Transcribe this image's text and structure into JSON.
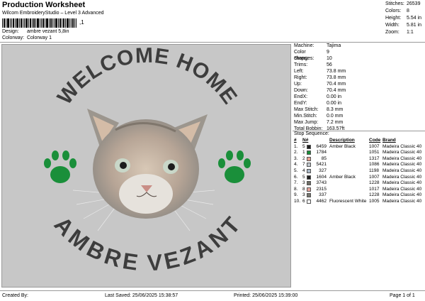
{
  "header": {
    "title": "Production Worksheet",
    "subtitle": "Wilcom EmbroideryStudio – Level 3 Advanced",
    "barcode_number": ",1",
    "design_label": "Design:",
    "design_value": "ambre vezant 5,8in",
    "colorway_label": "Colorway:",
    "colorway_value": "Colorway 1"
  },
  "stats": [
    {
      "label": "Stitches:",
      "value": "26539"
    },
    {
      "label": "Colors:",
      "value": "8"
    },
    {
      "label": "Height:",
      "value": "5.54 in"
    },
    {
      "label": "Width:",
      "value": "5.81 in"
    },
    {
      "label": "Zoom:",
      "value": "1:1"
    }
  ],
  "design": {
    "top_text": "WELCOME HOME",
    "bottom_text": "AMBRE VEZANT",
    "colors": {
      "background": "#c7c7c7",
      "text": "#3d3d3d",
      "paw": "#1a8f3a"
    }
  },
  "machine": [
    {
      "label": "Machine:",
      "value": "Tajima"
    },
    {
      "label": "Color changes:",
      "value": "9"
    },
    {
      "label": "Stops:",
      "value": "10"
    },
    {
      "label": "Trims:",
      "value": "56"
    },
    {
      "label": "Left:",
      "value": "73.8 mm"
    },
    {
      "label": "Right:",
      "value": "73.8 mm"
    },
    {
      "label": "Up:",
      "value": "70.4 mm"
    },
    {
      "label": "Down:",
      "value": "70.4 mm"
    },
    {
      "label": "EndX:",
      "value": "0.00 in"
    },
    {
      "label": "EndY:",
      "value": "0.00 in"
    },
    {
      "label": "Max Stitch:",
      "value": "8.3 mm"
    },
    {
      "label": "Min.Stitch:",
      "value": "0.0 mm"
    },
    {
      "label": "Max Jump:",
      "value": "7.2 mm"
    },
    {
      "label": "Total Bobbin:",
      "value": "163.57ft"
    }
  ],
  "sequence": {
    "title": "Stop Sequence:",
    "headers": {
      "num": "#",
      "n": "N#",
      "desc": "Description",
      "code": "Code",
      "brand": "Brand"
    },
    "rows": [
      {
        "num": "1.",
        "n": "5",
        "color": "#1f1f1f",
        "code_no": "6459",
        "desc": "Amber Black",
        "code": "1007",
        "brand": "Madeira Classic 40"
      },
      {
        "num": "2.",
        "n": "1",
        "color": "#1a8f3a",
        "code_no": "1784",
        "desc": "",
        "code": "1051",
        "brand": "Madeira Classic 40"
      },
      {
        "num": "3.",
        "n": "2",
        "color": "#e9a090",
        "code_no": "85",
        "desc": "",
        "code": "1317",
        "brand": "Madeira Classic 40"
      },
      {
        "num": "4.",
        "n": "7",
        "color": "#bfc6cc",
        "code_no": "5421",
        "desc": "",
        "code": "1086",
        "brand": "Madeira Classic 40"
      },
      {
        "num": "5.",
        "n": "4",
        "color": "#a9b8c6",
        "code_no": "327",
        "desc": "",
        "code": "1198",
        "brand": "Madeira Classic 40"
      },
      {
        "num": "6.",
        "n": "5",
        "color": "#1f1f1f",
        "code_no": "1604",
        "desc": "Amber Black",
        "code": "1007",
        "brand": "Madeira Classic 40"
      },
      {
        "num": "7.",
        "n": "3",
        "color": "#6e6e66",
        "code_no": "3743",
        "desc": "",
        "code": "1228",
        "brand": "Madeira Classic 40"
      },
      {
        "num": "8.",
        "n": "8",
        "color": "#e7a49a",
        "code_no": "2315",
        "desc": "",
        "code": "1017",
        "brand": "Madeira Classic 40"
      },
      {
        "num": "9.",
        "n": "3",
        "color": "#777770",
        "code_no": "337",
        "desc": "",
        "code": "1228",
        "brand": "Madeira Classic 40"
      },
      {
        "num": "10.",
        "n": "6",
        "color": "#f4f4f4",
        "code_no": "4462",
        "desc": "Fluorescent White",
        "code": "1005",
        "brand": "Madeira Classic 40"
      }
    ]
  },
  "footer": {
    "created": "Created By:",
    "saved": "Last Saved: 25/06/2025 15:38:57",
    "printed": "Printed: 25/06/2025 15:39:00",
    "page": "Page 1 of 1"
  }
}
